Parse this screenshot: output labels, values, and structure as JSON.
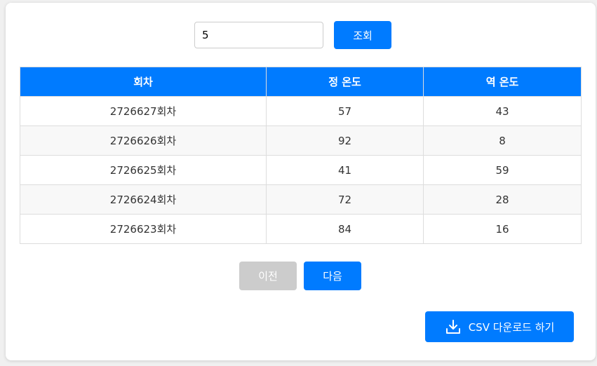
{
  "search": {
    "value": "5",
    "button_label": "조회"
  },
  "table": {
    "headers": [
      "회차",
      "정 온도",
      "역 온도"
    ],
    "rows": [
      [
        "2726627회차",
        "57",
        "43"
      ],
      [
        "2726626회차",
        "92",
        "8"
      ],
      [
        "2726625회차",
        "41",
        "59"
      ],
      [
        "2726624회차",
        "72",
        "28"
      ],
      [
        "2726623회차",
        "84",
        "16"
      ]
    ]
  },
  "pagination": {
    "prev_label": "이전",
    "next_label": "다음"
  },
  "download": {
    "icon": "download-icon",
    "label": "CSV 다운로드 하기"
  },
  "colors": {
    "primary": "#007bff",
    "disabled": "#cccccc",
    "row_alt": "#f8f8f8"
  }
}
